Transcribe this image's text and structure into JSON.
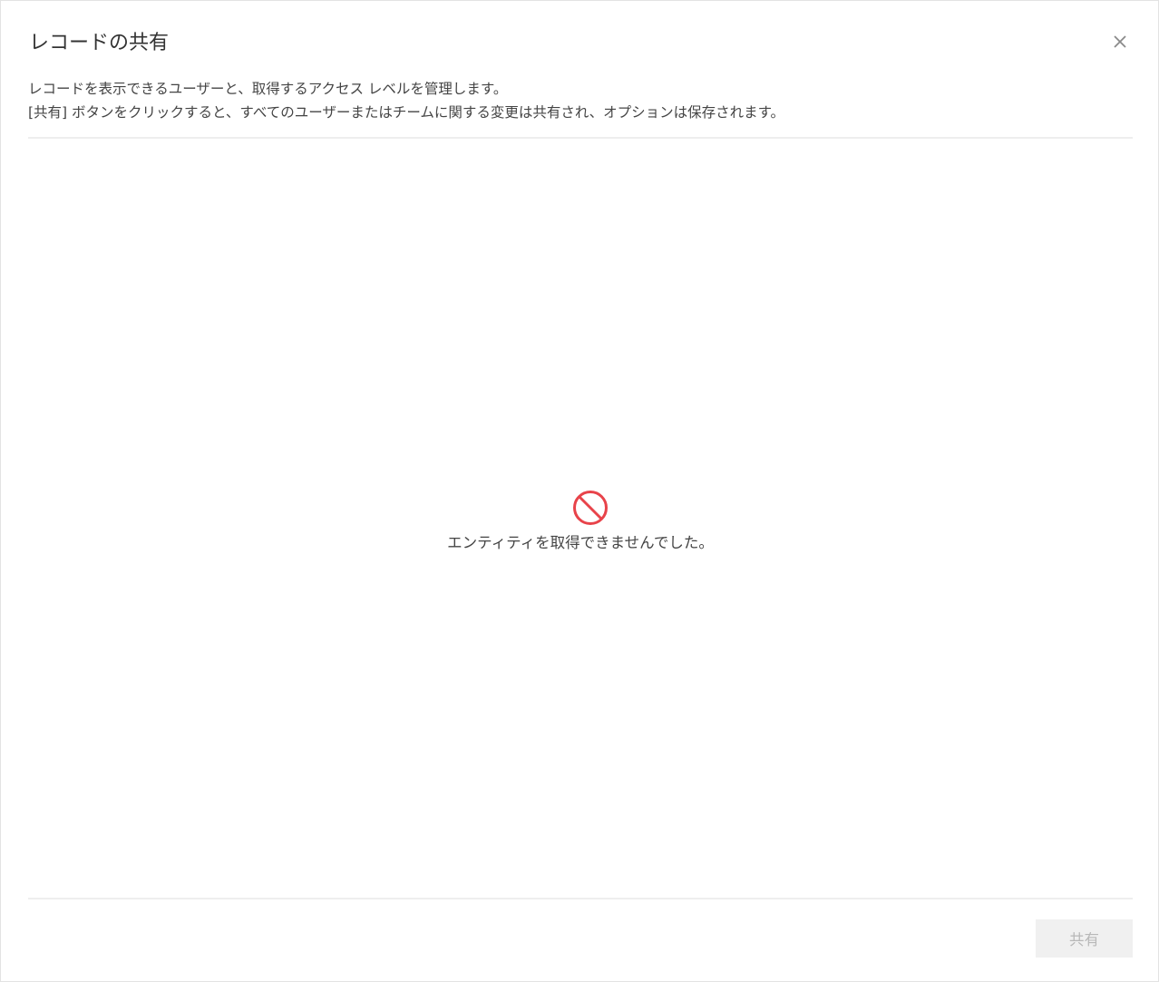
{
  "dialog": {
    "title": "レコードの共有",
    "close_icon": "close-icon",
    "description_line1": "レコードを表示できるユーザーと、取得するアクセス レベルを管理します。",
    "description_line2": "[共有] ボタンをクリックすると、すべてのユーザーまたはチームに関する変更は共有され、オプションは保存されます。"
  },
  "empty_state": {
    "icon": "blocked-icon",
    "icon_color": "#e8434a",
    "message": "エンティティを取得できませんでした。"
  },
  "footer": {
    "share_label": "共有",
    "share_disabled": true
  }
}
